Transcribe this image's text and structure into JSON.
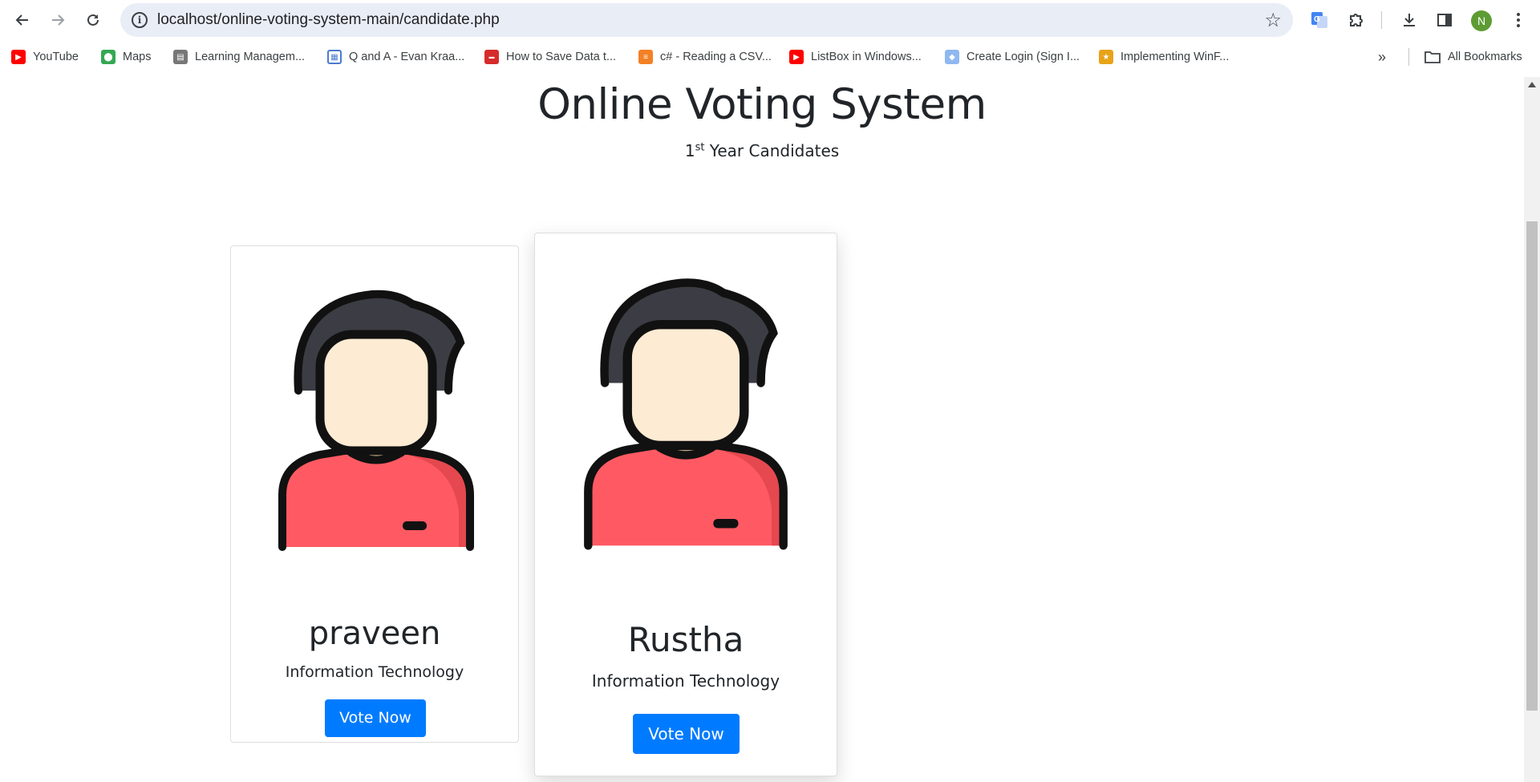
{
  "browser": {
    "url": "localhost/online-voting-system-main/candidate.php",
    "profile_initial": "N",
    "bookmarks": [
      {
        "label": "YouTube"
      },
      {
        "label": "Maps"
      },
      {
        "label": "Learning Managem..."
      },
      {
        "label": "Q and A - Evan Kraa..."
      },
      {
        "label": "How to Save Data t..."
      },
      {
        "label": "c# - Reading a CSV..."
      },
      {
        "label": "ListBox in Windows..."
      },
      {
        "label": "Create Login (Sign I..."
      },
      {
        "label": "Implementing WinF..."
      }
    ],
    "all_bookmarks_label": "All Bookmarks"
  },
  "page": {
    "title": "Online Voting System",
    "subtitle_ordinal": "1",
    "subtitle_suffix": "st",
    "subtitle_rest": " Year Candidates"
  },
  "candidates": [
    {
      "name": "praveen",
      "department": "Information Technology",
      "button": "Vote Now"
    },
    {
      "name": "Rustha",
      "department": "Information Technology",
      "button": "Vote Now"
    }
  ],
  "icons": {
    "back": "arrow-left-icon",
    "forward": "arrow-right-icon",
    "reload": "reload-icon",
    "site_info": "info-icon",
    "bookmark_star": "star-icon",
    "translate": "google-translate-icon",
    "extensions": "puzzle-icon",
    "downloads": "download-icon",
    "side_panel": "side-panel-icon",
    "menu": "kebab-menu-icon",
    "overflow": "double-chevron-icon",
    "folder": "folder-icon"
  },
  "colors": {
    "vote_button": "#007bff",
    "avatar_shirt": "#ff5a63",
    "avatar_skin": "#feebd4",
    "avatar_hair": "#3c3c44"
  }
}
